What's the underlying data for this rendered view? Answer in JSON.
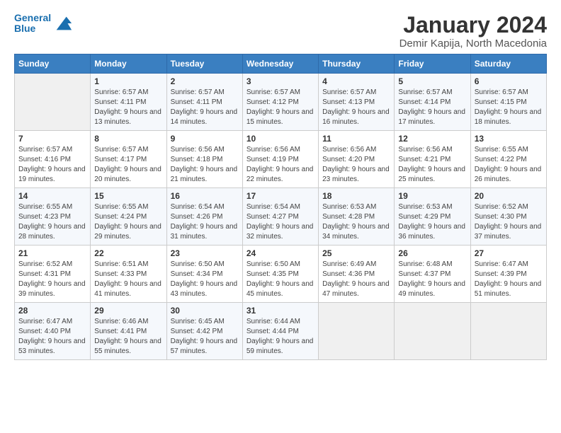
{
  "header": {
    "logo_line1": "General",
    "logo_line2": "Blue",
    "month": "January 2024",
    "location": "Demir Kapija, North Macedonia"
  },
  "days_of_week": [
    "Sunday",
    "Monday",
    "Tuesday",
    "Wednesday",
    "Thursday",
    "Friday",
    "Saturday"
  ],
  "weeks": [
    [
      {
        "day": "",
        "sunrise": "",
        "sunset": "",
        "daylight": ""
      },
      {
        "day": "1",
        "sunrise": "Sunrise: 6:57 AM",
        "sunset": "Sunset: 4:11 PM",
        "daylight": "Daylight: 9 hours and 13 minutes."
      },
      {
        "day": "2",
        "sunrise": "Sunrise: 6:57 AM",
        "sunset": "Sunset: 4:11 PM",
        "daylight": "Daylight: 9 hours and 14 minutes."
      },
      {
        "day": "3",
        "sunrise": "Sunrise: 6:57 AM",
        "sunset": "Sunset: 4:12 PM",
        "daylight": "Daylight: 9 hours and 15 minutes."
      },
      {
        "day": "4",
        "sunrise": "Sunrise: 6:57 AM",
        "sunset": "Sunset: 4:13 PM",
        "daylight": "Daylight: 9 hours and 16 minutes."
      },
      {
        "day": "5",
        "sunrise": "Sunrise: 6:57 AM",
        "sunset": "Sunset: 4:14 PM",
        "daylight": "Daylight: 9 hours and 17 minutes."
      },
      {
        "day": "6",
        "sunrise": "Sunrise: 6:57 AM",
        "sunset": "Sunset: 4:15 PM",
        "daylight": "Daylight: 9 hours and 18 minutes."
      }
    ],
    [
      {
        "day": "7",
        "sunrise": "Sunrise: 6:57 AM",
        "sunset": "Sunset: 4:16 PM",
        "daylight": "Daylight: 9 hours and 19 minutes."
      },
      {
        "day": "8",
        "sunrise": "Sunrise: 6:57 AM",
        "sunset": "Sunset: 4:17 PM",
        "daylight": "Daylight: 9 hours and 20 minutes."
      },
      {
        "day": "9",
        "sunrise": "Sunrise: 6:56 AM",
        "sunset": "Sunset: 4:18 PM",
        "daylight": "Daylight: 9 hours and 21 minutes."
      },
      {
        "day": "10",
        "sunrise": "Sunrise: 6:56 AM",
        "sunset": "Sunset: 4:19 PM",
        "daylight": "Daylight: 9 hours and 22 minutes."
      },
      {
        "day": "11",
        "sunrise": "Sunrise: 6:56 AM",
        "sunset": "Sunset: 4:20 PM",
        "daylight": "Daylight: 9 hours and 23 minutes."
      },
      {
        "day": "12",
        "sunrise": "Sunrise: 6:56 AM",
        "sunset": "Sunset: 4:21 PM",
        "daylight": "Daylight: 9 hours and 25 minutes."
      },
      {
        "day": "13",
        "sunrise": "Sunrise: 6:55 AM",
        "sunset": "Sunset: 4:22 PM",
        "daylight": "Daylight: 9 hours and 26 minutes."
      }
    ],
    [
      {
        "day": "14",
        "sunrise": "Sunrise: 6:55 AM",
        "sunset": "Sunset: 4:23 PM",
        "daylight": "Daylight: 9 hours and 28 minutes."
      },
      {
        "day": "15",
        "sunrise": "Sunrise: 6:55 AM",
        "sunset": "Sunset: 4:24 PM",
        "daylight": "Daylight: 9 hours and 29 minutes."
      },
      {
        "day": "16",
        "sunrise": "Sunrise: 6:54 AM",
        "sunset": "Sunset: 4:26 PM",
        "daylight": "Daylight: 9 hours and 31 minutes."
      },
      {
        "day": "17",
        "sunrise": "Sunrise: 6:54 AM",
        "sunset": "Sunset: 4:27 PM",
        "daylight": "Daylight: 9 hours and 32 minutes."
      },
      {
        "day": "18",
        "sunrise": "Sunrise: 6:53 AM",
        "sunset": "Sunset: 4:28 PM",
        "daylight": "Daylight: 9 hours and 34 minutes."
      },
      {
        "day": "19",
        "sunrise": "Sunrise: 6:53 AM",
        "sunset": "Sunset: 4:29 PM",
        "daylight": "Daylight: 9 hours and 36 minutes."
      },
      {
        "day": "20",
        "sunrise": "Sunrise: 6:52 AM",
        "sunset": "Sunset: 4:30 PM",
        "daylight": "Daylight: 9 hours and 37 minutes."
      }
    ],
    [
      {
        "day": "21",
        "sunrise": "Sunrise: 6:52 AM",
        "sunset": "Sunset: 4:31 PM",
        "daylight": "Daylight: 9 hours and 39 minutes."
      },
      {
        "day": "22",
        "sunrise": "Sunrise: 6:51 AM",
        "sunset": "Sunset: 4:33 PM",
        "daylight": "Daylight: 9 hours and 41 minutes."
      },
      {
        "day": "23",
        "sunrise": "Sunrise: 6:50 AM",
        "sunset": "Sunset: 4:34 PM",
        "daylight": "Daylight: 9 hours and 43 minutes."
      },
      {
        "day": "24",
        "sunrise": "Sunrise: 6:50 AM",
        "sunset": "Sunset: 4:35 PM",
        "daylight": "Daylight: 9 hours and 45 minutes."
      },
      {
        "day": "25",
        "sunrise": "Sunrise: 6:49 AM",
        "sunset": "Sunset: 4:36 PM",
        "daylight": "Daylight: 9 hours and 47 minutes."
      },
      {
        "day": "26",
        "sunrise": "Sunrise: 6:48 AM",
        "sunset": "Sunset: 4:37 PM",
        "daylight": "Daylight: 9 hours and 49 minutes."
      },
      {
        "day": "27",
        "sunrise": "Sunrise: 6:47 AM",
        "sunset": "Sunset: 4:39 PM",
        "daylight": "Daylight: 9 hours and 51 minutes."
      }
    ],
    [
      {
        "day": "28",
        "sunrise": "Sunrise: 6:47 AM",
        "sunset": "Sunset: 4:40 PM",
        "daylight": "Daylight: 9 hours and 53 minutes."
      },
      {
        "day": "29",
        "sunrise": "Sunrise: 6:46 AM",
        "sunset": "Sunset: 4:41 PM",
        "daylight": "Daylight: 9 hours and 55 minutes."
      },
      {
        "day": "30",
        "sunrise": "Sunrise: 6:45 AM",
        "sunset": "Sunset: 4:42 PM",
        "daylight": "Daylight: 9 hours and 57 minutes."
      },
      {
        "day": "31",
        "sunrise": "Sunrise: 6:44 AM",
        "sunset": "Sunset: 4:44 PM",
        "daylight": "Daylight: 9 hours and 59 minutes."
      },
      {
        "day": "",
        "sunrise": "",
        "sunset": "",
        "daylight": ""
      },
      {
        "day": "",
        "sunrise": "",
        "sunset": "",
        "daylight": ""
      },
      {
        "day": "",
        "sunrise": "",
        "sunset": "",
        "daylight": ""
      }
    ]
  ]
}
